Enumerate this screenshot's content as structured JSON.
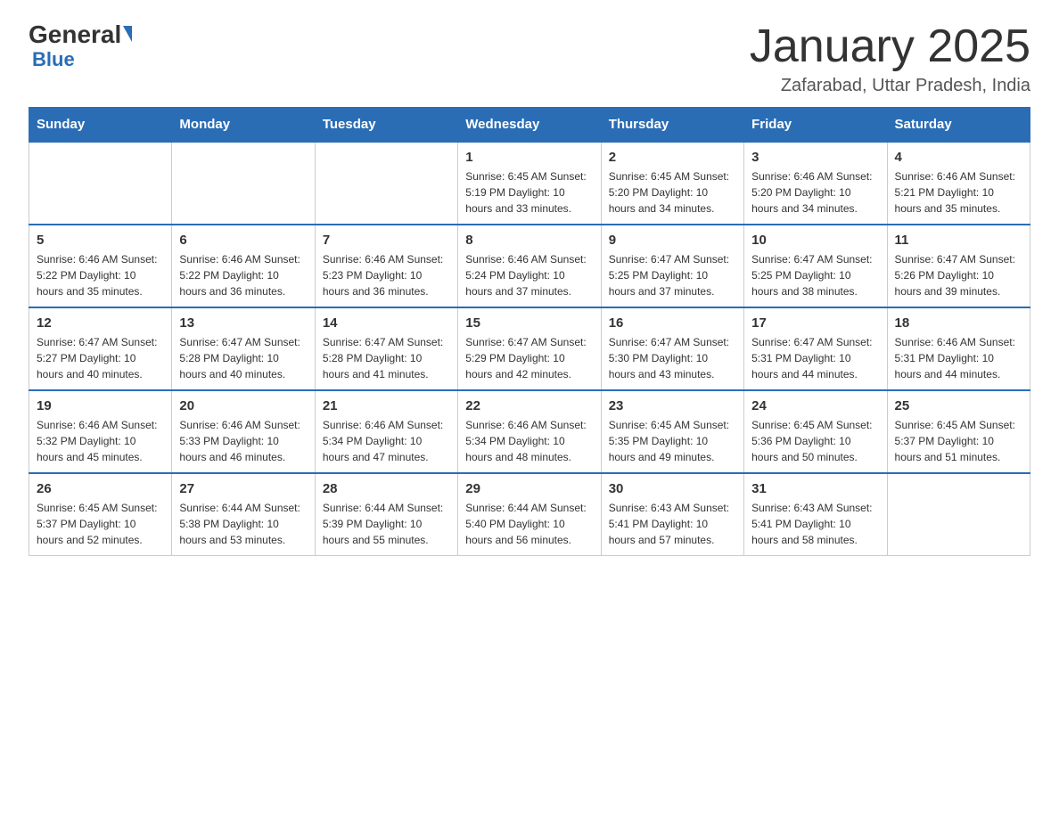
{
  "logo": {
    "general": "General",
    "blue": "Blue"
  },
  "header": {
    "title": "January 2025",
    "subtitle": "Zafarabad, Uttar Pradesh, India"
  },
  "days_of_week": [
    "Sunday",
    "Monday",
    "Tuesday",
    "Wednesday",
    "Thursday",
    "Friday",
    "Saturday"
  ],
  "weeks": [
    [
      {
        "day": "",
        "info": ""
      },
      {
        "day": "",
        "info": ""
      },
      {
        "day": "",
        "info": ""
      },
      {
        "day": "1",
        "info": "Sunrise: 6:45 AM\nSunset: 5:19 PM\nDaylight: 10 hours\nand 33 minutes."
      },
      {
        "day": "2",
        "info": "Sunrise: 6:45 AM\nSunset: 5:20 PM\nDaylight: 10 hours\nand 34 minutes."
      },
      {
        "day": "3",
        "info": "Sunrise: 6:46 AM\nSunset: 5:20 PM\nDaylight: 10 hours\nand 34 minutes."
      },
      {
        "day": "4",
        "info": "Sunrise: 6:46 AM\nSunset: 5:21 PM\nDaylight: 10 hours\nand 35 minutes."
      }
    ],
    [
      {
        "day": "5",
        "info": "Sunrise: 6:46 AM\nSunset: 5:22 PM\nDaylight: 10 hours\nand 35 minutes."
      },
      {
        "day": "6",
        "info": "Sunrise: 6:46 AM\nSunset: 5:22 PM\nDaylight: 10 hours\nand 36 minutes."
      },
      {
        "day": "7",
        "info": "Sunrise: 6:46 AM\nSunset: 5:23 PM\nDaylight: 10 hours\nand 36 minutes."
      },
      {
        "day": "8",
        "info": "Sunrise: 6:46 AM\nSunset: 5:24 PM\nDaylight: 10 hours\nand 37 minutes."
      },
      {
        "day": "9",
        "info": "Sunrise: 6:47 AM\nSunset: 5:25 PM\nDaylight: 10 hours\nand 37 minutes."
      },
      {
        "day": "10",
        "info": "Sunrise: 6:47 AM\nSunset: 5:25 PM\nDaylight: 10 hours\nand 38 minutes."
      },
      {
        "day": "11",
        "info": "Sunrise: 6:47 AM\nSunset: 5:26 PM\nDaylight: 10 hours\nand 39 minutes."
      }
    ],
    [
      {
        "day": "12",
        "info": "Sunrise: 6:47 AM\nSunset: 5:27 PM\nDaylight: 10 hours\nand 40 minutes."
      },
      {
        "day": "13",
        "info": "Sunrise: 6:47 AM\nSunset: 5:28 PM\nDaylight: 10 hours\nand 40 minutes."
      },
      {
        "day": "14",
        "info": "Sunrise: 6:47 AM\nSunset: 5:28 PM\nDaylight: 10 hours\nand 41 minutes."
      },
      {
        "day": "15",
        "info": "Sunrise: 6:47 AM\nSunset: 5:29 PM\nDaylight: 10 hours\nand 42 minutes."
      },
      {
        "day": "16",
        "info": "Sunrise: 6:47 AM\nSunset: 5:30 PM\nDaylight: 10 hours\nand 43 minutes."
      },
      {
        "day": "17",
        "info": "Sunrise: 6:47 AM\nSunset: 5:31 PM\nDaylight: 10 hours\nand 44 minutes."
      },
      {
        "day": "18",
        "info": "Sunrise: 6:46 AM\nSunset: 5:31 PM\nDaylight: 10 hours\nand 44 minutes."
      }
    ],
    [
      {
        "day": "19",
        "info": "Sunrise: 6:46 AM\nSunset: 5:32 PM\nDaylight: 10 hours\nand 45 minutes."
      },
      {
        "day": "20",
        "info": "Sunrise: 6:46 AM\nSunset: 5:33 PM\nDaylight: 10 hours\nand 46 minutes."
      },
      {
        "day": "21",
        "info": "Sunrise: 6:46 AM\nSunset: 5:34 PM\nDaylight: 10 hours\nand 47 minutes."
      },
      {
        "day": "22",
        "info": "Sunrise: 6:46 AM\nSunset: 5:34 PM\nDaylight: 10 hours\nand 48 minutes."
      },
      {
        "day": "23",
        "info": "Sunrise: 6:45 AM\nSunset: 5:35 PM\nDaylight: 10 hours\nand 49 minutes."
      },
      {
        "day": "24",
        "info": "Sunrise: 6:45 AM\nSunset: 5:36 PM\nDaylight: 10 hours\nand 50 minutes."
      },
      {
        "day": "25",
        "info": "Sunrise: 6:45 AM\nSunset: 5:37 PM\nDaylight: 10 hours\nand 51 minutes."
      }
    ],
    [
      {
        "day": "26",
        "info": "Sunrise: 6:45 AM\nSunset: 5:37 PM\nDaylight: 10 hours\nand 52 minutes."
      },
      {
        "day": "27",
        "info": "Sunrise: 6:44 AM\nSunset: 5:38 PM\nDaylight: 10 hours\nand 53 minutes."
      },
      {
        "day": "28",
        "info": "Sunrise: 6:44 AM\nSunset: 5:39 PM\nDaylight: 10 hours\nand 55 minutes."
      },
      {
        "day": "29",
        "info": "Sunrise: 6:44 AM\nSunset: 5:40 PM\nDaylight: 10 hours\nand 56 minutes."
      },
      {
        "day": "30",
        "info": "Sunrise: 6:43 AM\nSunset: 5:41 PM\nDaylight: 10 hours\nand 57 minutes."
      },
      {
        "day": "31",
        "info": "Sunrise: 6:43 AM\nSunset: 5:41 PM\nDaylight: 10 hours\nand 58 minutes."
      },
      {
        "day": "",
        "info": ""
      }
    ]
  ]
}
